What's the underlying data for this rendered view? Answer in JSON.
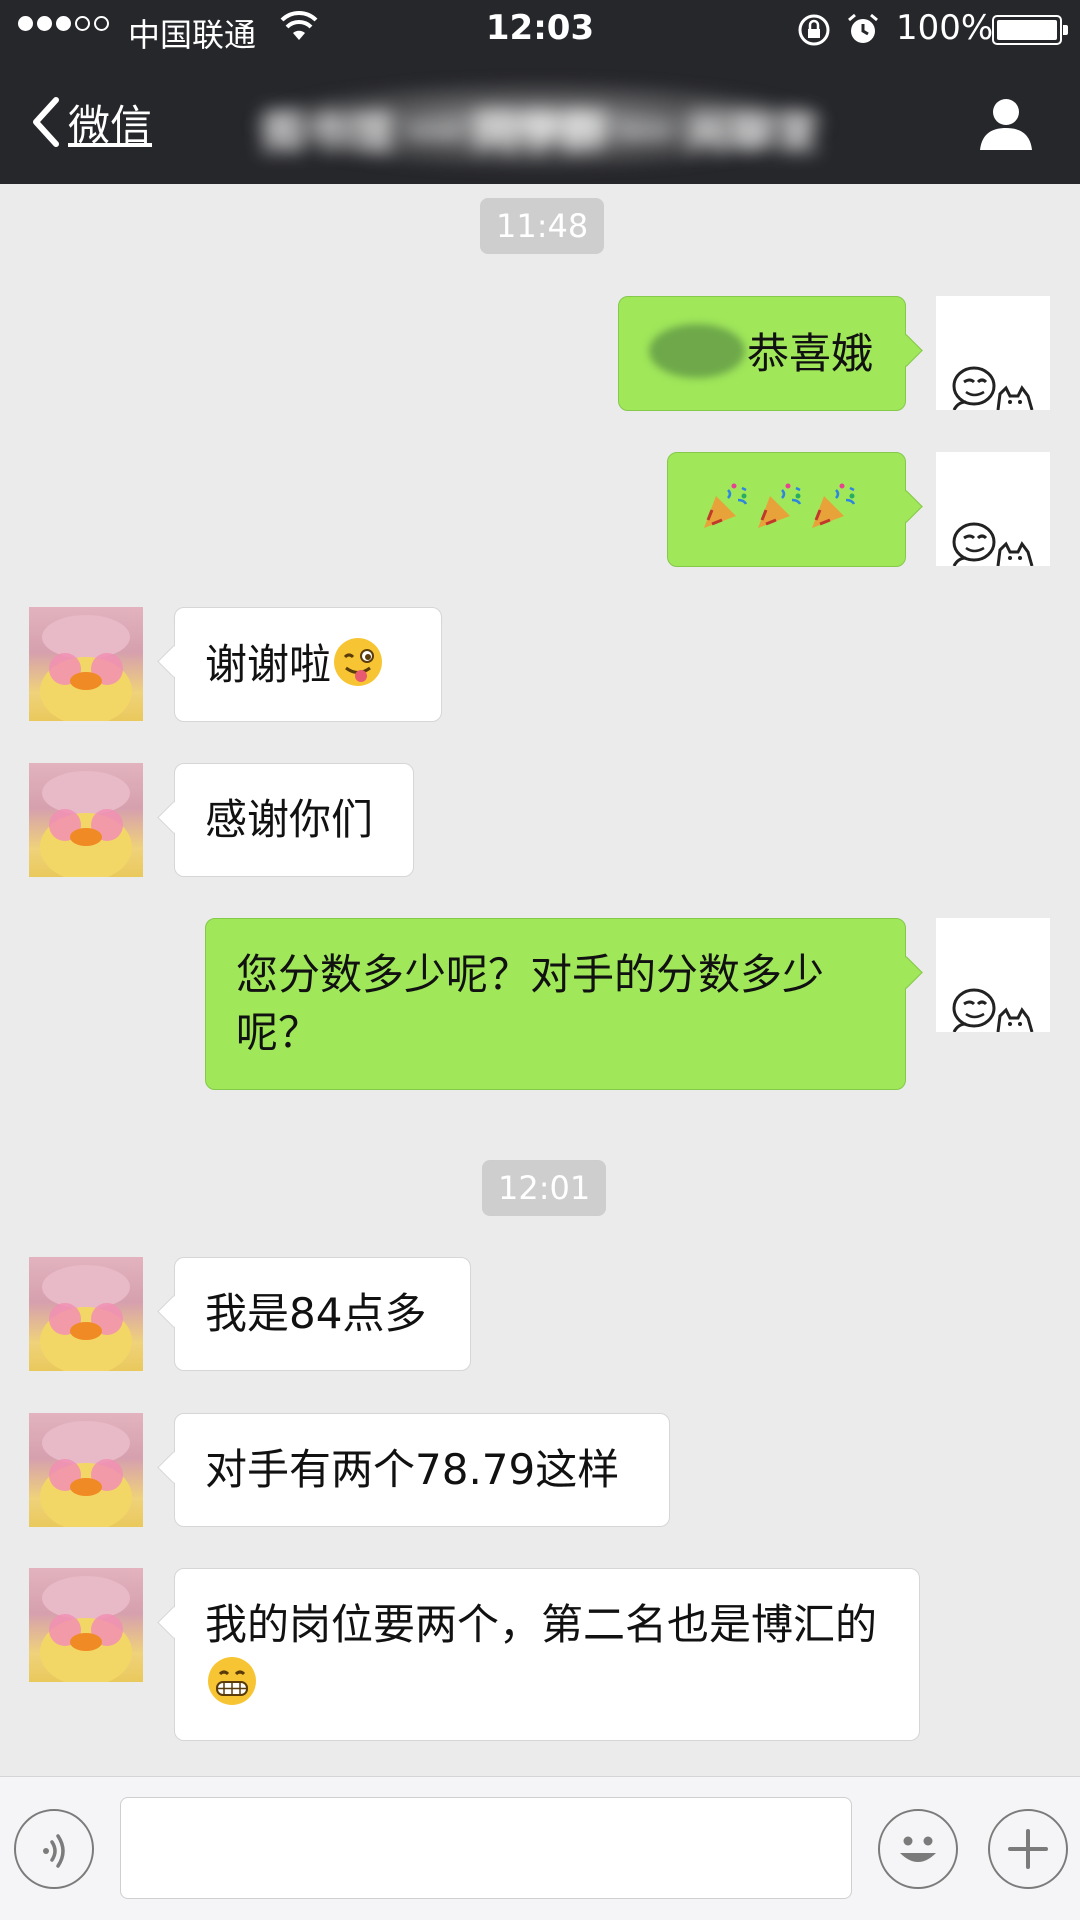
{
  "status_bar": {
    "carrier": "中国联通",
    "time": "12:03",
    "battery": "100%",
    "signal_bars_filled": 3,
    "signal_bars_total": 5
  },
  "nav": {
    "back_label": "微信",
    "title": "图书馆 ··· 同学群 ··· 闲聊室",
    "title_obscured": true
  },
  "messages": {
    "ts1": "11:48",
    "m1_text": "恭喜娥",
    "m3_text": "谢谢啦",
    "m4_text": "感谢你们",
    "m5_text": "您分数多少呢？对手的分数多少呢？",
    "ts2": "12:01",
    "m6_text": "我是84点多",
    "m7_text": "对手有两个78.79这样",
    "m8_text": "我的岗位要两个，第二名也是博汇的"
  },
  "input": {
    "placeholder": ""
  },
  "colors": {
    "nav_bg": "#26272b",
    "chat_bg": "#ebebeb",
    "bubble_out": "#a0e75a",
    "bubble_in": "#ffffff",
    "timestamp_bg": "#cecece"
  },
  "icons": [
    "signal-dots",
    "wifi-icon",
    "rotation-lock-icon",
    "alarm-icon",
    "battery-icon",
    "chevron-left-icon",
    "person-icon",
    "party-popper-emoji",
    "winking-tongue-emoji",
    "grinning-emoji",
    "voice-icon",
    "emoji-face-icon",
    "plus-icon"
  ]
}
